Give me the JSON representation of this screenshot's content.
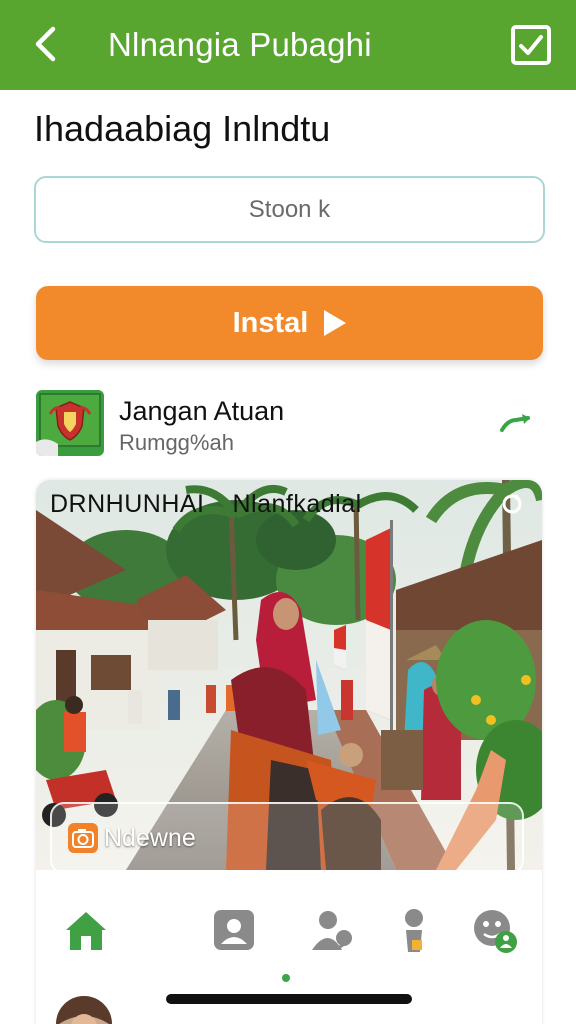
{
  "app_bar": {
    "title": "Nlnangia Pubaghi",
    "back_icon": "arrow-left-icon",
    "action_icon": "checkbox-checked-icon",
    "color": "#58a630"
  },
  "page": {
    "heading": "Ihadaabiag Inlndtu"
  },
  "search": {
    "placeholder": "Stoon k"
  },
  "install_button": {
    "label": "Instal",
    "icon": "play-icon",
    "color": "#f28a2b"
  },
  "app_row": {
    "name": "Jangan Atuan",
    "subtitle": "Rumgg%ah",
    "trend_icon": "trend-arrow-icon"
  },
  "feed": {
    "caption_left": "DRNHUNHAI",
    "caption_right": "Nlanfkadial",
    "pill_label": "Ndewne",
    "pill_icon": "camera-icon"
  },
  "bottom_nav": {
    "items": [
      {
        "icon": "home-icon",
        "active": true
      },
      {
        "icon": "contact-card-icon",
        "active": false
      },
      {
        "icon": "person-chat-icon",
        "active": false
      },
      {
        "icon": "person-lock-icon",
        "active": false
      },
      {
        "icon": "profile-badge-icon",
        "active": false
      }
    ]
  }
}
